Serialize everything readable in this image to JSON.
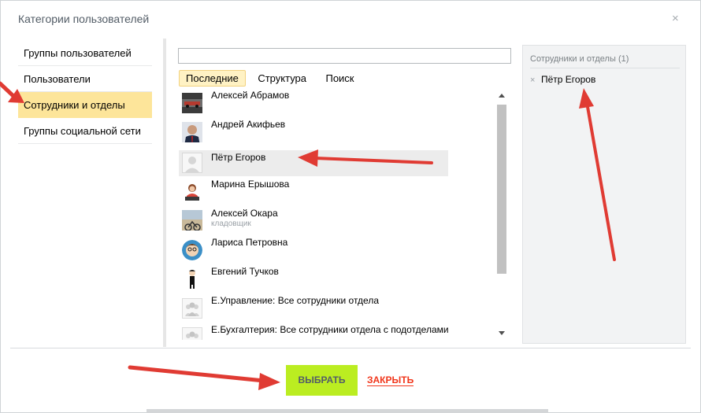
{
  "dialog": {
    "title": "Категории пользователей",
    "close_glyph": "×"
  },
  "categories": [
    {
      "label": "Группы пользователей",
      "active": false
    },
    {
      "label": "Пользователи",
      "active": false
    },
    {
      "label": "Сотрудники и отделы",
      "active": true
    },
    {
      "label": "Группы социальной сети",
      "active": false
    }
  ],
  "search": {
    "value": "",
    "placeholder": ""
  },
  "tabs": [
    {
      "label": "Последние",
      "active": true
    },
    {
      "label": "Структура",
      "active": false
    },
    {
      "label": "Поиск",
      "active": false
    }
  ],
  "entries": [
    {
      "name": "Алексей Абрамов",
      "subtitle": "",
      "avatar": "photo-car",
      "selected": false
    },
    {
      "name": "Андрей Акифьев",
      "subtitle": "",
      "avatar": "photo-man",
      "selected": false
    },
    {
      "name": "Пётр Егоров",
      "subtitle": "",
      "avatar": "default-user",
      "selected": true
    },
    {
      "name": "Марина Ерышова",
      "subtitle": "",
      "avatar": "photo-woman-laptop",
      "selected": false
    },
    {
      "name": "Алексей Окара",
      "subtitle": "кладовщик",
      "avatar": "photo-bike",
      "selected": false
    },
    {
      "name": "Лариса Петровна",
      "subtitle": "",
      "avatar": "cartoon-woman",
      "selected": false
    },
    {
      "name": "Евгений Тучков",
      "subtitle": "",
      "avatar": "cartoon-man",
      "selected": false
    },
    {
      "name": "Е.Управление: Все сотрудники отдела",
      "subtitle": "",
      "avatar": "department",
      "selected": false
    },
    {
      "name": "Е.Бухгалтерия: Все сотрудники отдела с подотделами",
      "subtitle": "",
      "avatar": "department",
      "selected": false
    }
  ],
  "selected_panel": {
    "title": "Сотрудники и отделы (1)",
    "remove_glyph": "×",
    "items": [
      "Пётр Егоров"
    ]
  },
  "footer": {
    "select_label": "ВЫБРАТЬ",
    "close_label": "ЗАКРЫТЬ"
  },
  "colors": {
    "active_category": "#fde59a",
    "select_button": "#bbed21",
    "close_link": "#f1361b",
    "annotation_arrow": "#e03b33"
  }
}
